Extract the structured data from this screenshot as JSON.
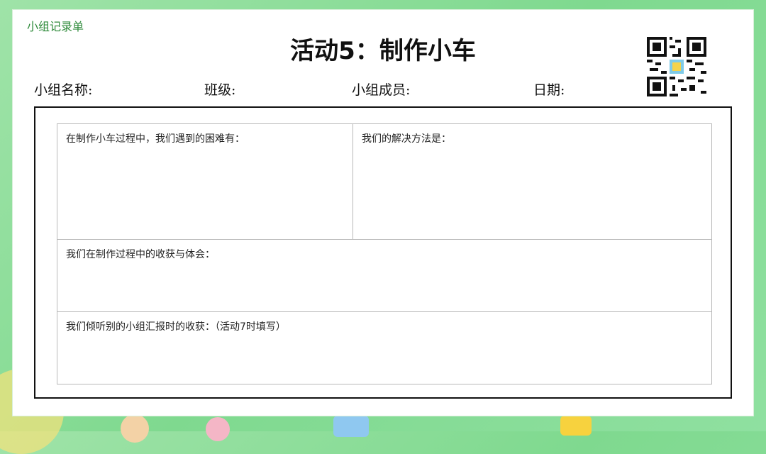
{
  "header": {
    "corner_label": "小组记录单",
    "title": "活动5：制作小车"
  },
  "info_fields": {
    "group_name": "小组名称:",
    "class": "班级:",
    "members": "小组成员:",
    "date": "日期:"
  },
  "sections": {
    "difficulties": "在制作小车过程中，我们遇到的困难有：",
    "solutions": "我们的解决方法是：",
    "gains": "我们在制作过程中的收获与体会：",
    "listening": "我们倾听别的小组汇报时的收获：（活动7时填写）"
  },
  "colors": {
    "background": "#8fe0a0",
    "accent": "#2e8a3a"
  },
  "icons": {
    "qr": "qr-code-icon"
  }
}
